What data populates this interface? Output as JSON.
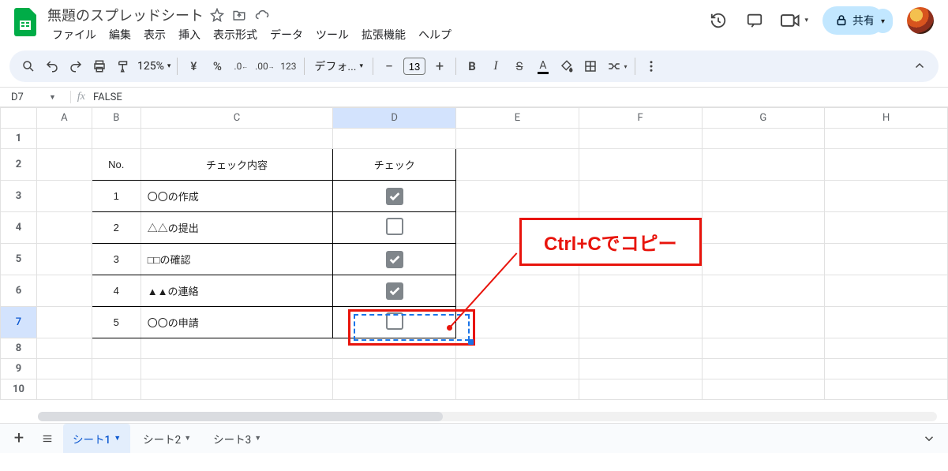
{
  "doc": {
    "title": "無題のスプレッドシート"
  },
  "menus": [
    "ファイル",
    "編集",
    "表示",
    "挿入",
    "表示形式",
    "データ",
    "ツール",
    "拡張機能",
    "ヘルプ"
  ],
  "toolbar": {
    "zoom": "125%",
    "font": "デフォ...",
    "font_size": "13"
  },
  "share": {
    "label": "共有"
  },
  "namebox": {
    "cell": "D7",
    "formula": "FALSE"
  },
  "columns": [
    "A",
    "B",
    "C",
    "D",
    "E",
    "F",
    "G",
    "H"
  ],
  "row_headers": [
    "1",
    "2",
    "3",
    "4",
    "5",
    "6",
    "7",
    "8",
    "9",
    "10"
  ],
  "table": {
    "headers": {
      "no": "No.",
      "content": "チェック内容",
      "check": "チェック"
    },
    "rows": [
      {
        "no": "1",
        "content": "〇〇の作成",
        "checked": true
      },
      {
        "no": "2",
        "content": "△△の提出",
        "checked": false
      },
      {
        "no": "3",
        "content": "□□の確認",
        "checked": true
      },
      {
        "no": "4",
        "content": "▲▲の連絡",
        "checked": true
      },
      {
        "no": "5",
        "content": "〇〇の申請",
        "checked": false
      }
    ]
  },
  "annotation": {
    "text": "Ctrl+Cでコピー"
  },
  "sheets": {
    "tabs": [
      "シート1",
      "シート2",
      "シート3"
    ],
    "active": 0
  }
}
